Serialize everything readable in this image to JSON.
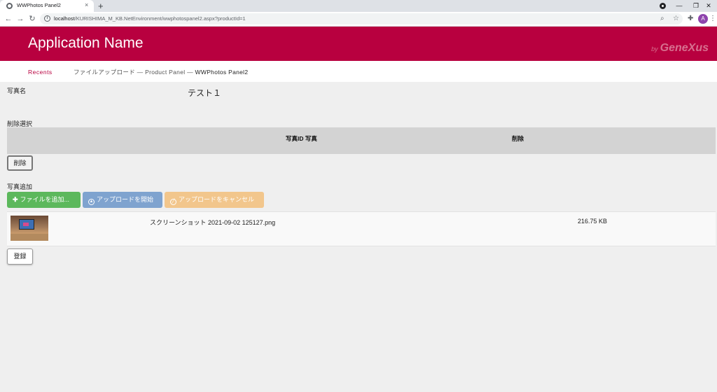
{
  "browser": {
    "tab_title": "WWPhotos Panel2",
    "tab_close": "×",
    "new_tab": "+",
    "url_host": "localhost",
    "url_path": "/KURISHIMA_M_KB.NetEnvironment/wwphotospanel2.aspx?productId=1",
    "controls": {
      "minimize": "—",
      "maximize": "❐",
      "close": "✕"
    },
    "avatar_letter": "A"
  },
  "header": {
    "app_title": "Application Name",
    "brand_by": "by",
    "brand_name": "GeneXus"
  },
  "breadcrumb": {
    "recents": "Recents",
    "path": "ファイルアップロード — Product Panel — ",
    "current": "WWPhotos Panel2"
  },
  "form": {
    "photo_name_label": "写真名",
    "photo_name_value": "テスト１",
    "delete_section_label": "削除選択",
    "grid_columns": [
      "写真ID 写真",
      "削除"
    ],
    "delete_button": "削除",
    "add_section_label": "写真追加",
    "upload_buttons": {
      "add_files": "ファイルを追加...",
      "start_upload": "アップロードを開始",
      "cancel_upload": "アップロードをキャンセル"
    },
    "files": [
      {
        "name": "スクリーンショット 2021-09-02 125127.png",
        "size": "216.75 KB"
      }
    ],
    "register_button": "登録"
  },
  "colors": {
    "brand": "#b8003f",
    "add_green": "#5cb85c",
    "start_blue": "#7fa3cf",
    "cancel_orange": "#f2c68c"
  },
  "icons": {
    "tab_favicon": "globe-icon",
    "back": "arrow-left-icon",
    "forward": "arrow-right-icon",
    "reload": "reload-icon",
    "zoom": "zoom-icon",
    "bookmark": "star-icon",
    "extensions": "puzzle-icon",
    "add": "plus-icon",
    "start": "upload-circle-icon",
    "cancel": "ban-circle-icon"
  }
}
